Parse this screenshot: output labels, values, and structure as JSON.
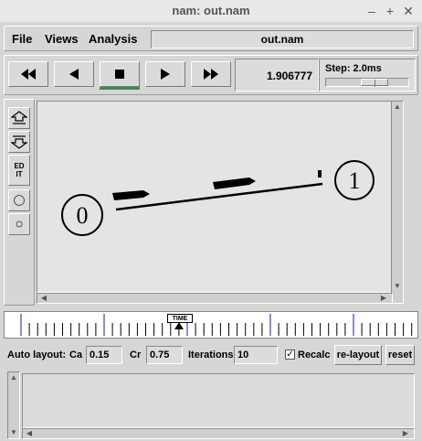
{
  "window": {
    "title": "nam: out.nam",
    "controls": [
      "–",
      "+",
      "✕"
    ]
  },
  "menu": {
    "file": "File",
    "views": "Views",
    "analysis": "Analysis"
  },
  "filename": "out.nam",
  "playback": {
    "buttons": [
      {
        "name": "rewind-button",
        "icon": "fast-backward-icon",
        "glyph": "◀◀"
      },
      {
        "name": "play-backward-button",
        "icon": "backward-icon",
        "glyph": "◀"
      },
      {
        "name": "stop-button",
        "icon": "stop-icon",
        "glyph": "■"
      },
      {
        "name": "play-forward-button",
        "icon": "forward-icon",
        "glyph": "▶"
      },
      {
        "name": "fast-forward-button",
        "icon": "fast-forward-icon",
        "glyph": "▶▶"
      }
    ],
    "current_time": "1.906777",
    "step_label": "Step: 2.0ms"
  },
  "tools": {
    "edit_label_1": "ED",
    "edit_label_2": "IT"
  },
  "network": {
    "nodes": [
      {
        "id": "0"
      },
      {
        "id": "1"
      }
    ]
  },
  "timeline": {
    "label": "TIME"
  },
  "autolayout": {
    "label": "Auto layout:",
    "ca_label": "Ca",
    "ca_value": "0.15",
    "cr_label": "Cr",
    "cr_value": "0.75",
    "iterations_label": "Iterations",
    "iterations_value": "10",
    "recalc_label": "Recalc",
    "recalc_checked": true,
    "relayout_label": "re-layout",
    "reset_label": "reset"
  },
  "colors": {
    "stop_indicator": "#3c8a5a",
    "timeline_major": "#1a1aa0"
  }
}
